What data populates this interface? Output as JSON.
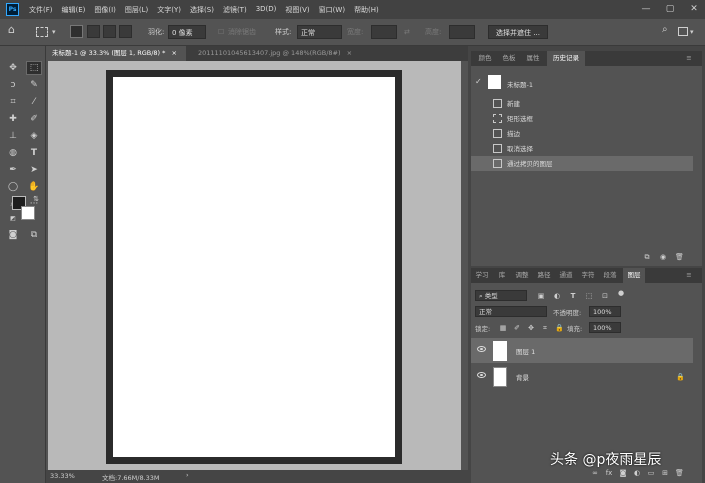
{
  "app": {
    "logo": "Ps"
  },
  "menu": [
    "文件(F)",
    "编辑(E)",
    "图像(I)",
    "图层(L)",
    "文字(Y)",
    "选择(S)",
    "滤镜(T)",
    "3D(D)",
    "视图(V)",
    "窗口(W)",
    "帮助(H)"
  ],
  "window_controls": {
    "minimize": "—",
    "maximize": "▢",
    "close": "✕"
  },
  "options": {
    "feather_label": "羽化:",
    "feather_value": "0 像素",
    "antialias_label": "消除锯齿",
    "style_label": "样式:",
    "style_value": "正常",
    "width_label": "宽度:",
    "height_label": "高度:",
    "select_mask_button": "选择并遮住 ..."
  },
  "doc_tabs": [
    {
      "label": "未标题-1 @ 33.3% (图层 1, RGB/8) *",
      "close": "×",
      "active": true
    },
    {
      "label": "20111101045613407.jpg @ 148%(RGB/8#)",
      "close": "×",
      "active": false
    }
  ],
  "status": {
    "zoom": "33.33%",
    "doc_info": "文档:7.66M/8.33M",
    "arrow": "›"
  },
  "history_panel": {
    "tabs": [
      "颜色",
      "色板",
      "属性",
      "历史记录"
    ],
    "active_tab": "历史记录",
    "snapshot": "未标题-1",
    "items": [
      "新建",
      "矩形选框",
      "描边",
      "取消选择",
      "通过拷贝的图层"
    ],
    "selected_index": 4
  },
  "layers_panel": {
    "tabs": [
      "学习",
      "库",
      "调整",
      "路径",
      "通道",
      "字符",
      "段落",
      "图层"
    ],
    "active_tab": "图层",
    "filter_kind": "类型",
    "blend_mode": "正常",
    "opacity_label": "不透明度:",
    "opacity_value": "100%",
    "lock_label": "锁定:",
    "fill_label": "填充:",
    "fill_value": "100%",
    "layers": [
      {
        "name": "图层 1",
        "selected": true
      },
      {
        "name": "背景",
        "selected": false,
        "locked": true
      }
    ]
  },
  "watermark": "头条 @p夜雨星辰",
  "colors": {
    "accent": "#31a8ff",
    "panel_bg": "#535353",
    "dark_bg": "#3a3a3a",
    "canvas_bg": "#b9b9b9"
  }
}
